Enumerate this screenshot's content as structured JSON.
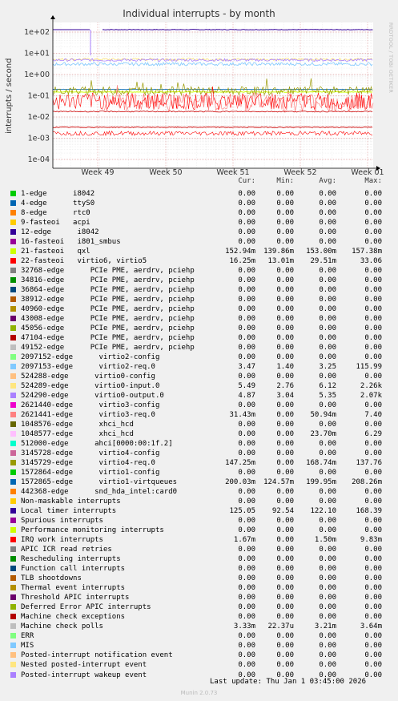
{
  "chart_data": {
    "type": "line",
    "title": "Individual interrupts - by month",
    "ylabel": "interrupts / second",
    "yscale": "log",
    "ylim": [
      0.0001,
      100
    ],
    "y_ticks": [
      "1e+02",
      "1e+01",
      "1e+00",
      "1e-01",
      "1e-02",
      "1e-03",
      "1e-04"
    ],
    "x_ticks": [
      "Week 49",
      "Week 50",
      "Week 51",
      "Week 52",
      "Week 01"
    ],
    "grid": true,
    "approx_lines": [
      {
        "name": "21-fasteoi   qxl",
        "level": 150,
        "color": "#330099"
      },
      {
        "name": "Local timer interrupts",
        "level": 2,
        "color": "#00ccff"
      },
      {
        "name": "virtio",
        "level": 0.15,
        "color": "#88aa00"
      },
      {
        "name": "22-fasteoi",
        "level": 0.02,
        "color": "#cc0000"
      },
      {
        "name": "Machine check polls",
        "level": 0.0033,
        "color": "#cc0000"
      }
    ]
  },
  "watermark": "RRDTOOL / TOBI OETIKER",
  "headers": {
    "cur": "Cur:",
    "min": "Min:",
    "avg": "Avg:",
    "max": "Max:"
  },
  "rows": [
    {
      "name": "1-edge      i8042",
      "color": "#00cc00",
      "cur": "0.00",
      "min": "0.00",
      "avg": "0.00",
      "max": "0.00"
    },
    {
      "name": "4-edge      ttyS0",
      "color": "#0066b3",
      "cur": "0.00",
      "min": "0.00",
      "avg": "0.00",
      "max": "0.00"
    },
    {
      "name": "8-edge      rtc0",
      "color": "#ff8000",
      "cur": "0.00",
      "min": "0.00",
      "avg": "0.00",
      "max": "0.00"
    },
    {
      "name": "9-fasteoi   acpi",
      "color": "#ffcc00",
      "cur": "0.00",
      "min": "0.00",
      "avg": "0.00",
      "max": "0.00"
    },
    {
      "name": "12-edge      i8042",
      "color": "#330099",
      "cur": "0.00",
      "min": "0.00",
      "avg": "0.00",
      "max": "0.00"
    },
    {
      "name": "16-fasteoi   i801_smbus",
      "color": "#990099",
      "cur": "0.00",
      "min": "0.00",
      "avg": "0.00",
      "max": "0.00"
    },
    {
      "name": "21-fasteoi   qxl",
      "color": "#ccff00",
      "cur": "152.94m",
      "min": "139.86m",
      "avg": "153.00m",
      "max": "157.38m"
    },
    {
      "name": "22-fasteoi   virtio6, virtio5",
      "color": "#ff0000",
      "cur": "16.25m",
      "min": "13.01m",
      "avg": "29.51m",
      "max": "33.06"
    },
    {
      "name": "32768-edge      PCIe PME, aerdrv, pciehp",
      "color": "#808080",
      "cur": "0.00",
      "min": "0.00",
      "avg": "0.00",
      "max": "0.00"
    },
    {
      "name": "34816-edge      PCIe PME, aerdrv, pciehp",
      "color": "#008f00",
      "cur": "0.00",
      "min": "0.00",
      "avg": "0.00",
      "max": "0.00"
    },
    {
      "name": "36864-edge      PCIe PME, aerdrv, pciehp",
      "color": "#00487d",
      "cur": "0.00",
      "min": "0.00",
      "avg": "0.00",
      "max": "0.00"
    },
    {
      "name": "38912-edge      PCIe PME, aerdrv, pciehp",
      "color": "#b35a00",
      "cur": "0.00",
      "min": "0.00",
      "avg": "0.00",
      "max": "0.00"
    },
    {
      "name": "40960-edge      PCIe PME, aerdrv, pciehp",
      "color": "#b38f00",
      "cur": "0.00",
      "min": "0.00",
      "avg": "0.00",
      "max": "0.00"
    },
    {
      "name": "43008-edge      PCIe PME, aerdrv, pciehp",
      "color": "#6b006b",
      "cur": "0.00",
      "min": "0.00",
      "avg": "0.00",
      "max": "0.00"
    },
    {
      "name": "45056-edge      PCIe PME, aerdrv, pciehp",
      "color": "#8fb300",
      "cur": "0.00",
      "min": "0.00",
      "avg": "0.00",
      "max": "0.00"
    },
    {
      "name": "47104-edge      PCIe PME, aerdrv, pciehp",
      "color": "#b30000",
      "cur": "0.00",
      "min": "0.00",
      "avg": "0.00",
      "max": "0.00"
    },
    {
      "name": "49152-edge      PCIe PME, aerdrv, pciehp",
      "color": "#bebebe",
      "cur": "0.00",
      "min": "0.00",
      "avg": "0.00",
      "max": "0.00"
    },
    {
      "name": "2097152-edge      virtio2-config",
      "color": "#80ff80",
      "cur": "0.00",
      "min": "0.00",
      "avg": "0.00",
      "max": "0.00"
    },
    {
      "name": "2097153-edge      virtio2-req.0",
      "color": "#80c9ff",
      "cur": "3.47",
      "min": "1.40",
      "avg": "3.25",
      "max": "115.99"
    },
    {
      "name": "524288-edge      virtio0-config",
      "color": "#ffc080",
      "cur": "0.00",
      "min": "0.00",
      "avg": "0.00",
      "max": "0.00"
    },
    {
      "name": "524289-edge      virtio0-input.0",
      "color": "#ffe680",
      "cur": "5.49",
      "min": "2.76",
      "avg": "6.12",
      "max": "2.26k"
    },
    {
      "name": "524290-edge      virtio0-output.0",
      "color": "#aa80ff",
      "cur": "4.87",
      "min": "3.04",
      "avg": "5.35",
      "max": "2.07k"
    },
    {
      "name": "2621440-edge      virtio3-config",
      "color": "#ee00cc",
      "cur": "0.00",
      "min": "0.00",
      "avg": "0.00",
      "max": "0.00"
    },
    {
      "name": "2621441-edge      virtio3-req.0",
      "color": "#ff8080",
      "cur": "31.43m",
      "min": "0.00",
      "avg": "50.94m",
      "max": "7.40"
    },
    {
      "name": "1048576-edge      xhci_hcd",
      "color": "#666600",
      "cur": "0.00",
      "min": "0.00",
      "avg": "0.00",
      "max": "0.00"
    },
    {
      "name": "1048577-edge      xhci_hcd",
      "color": "#ffbfff",
      "cur": "0.00",
      "min": "0.00",
      "avg": "23.70m",
      "max": "6.29"
    },
    {
      "name": "512000-edge      ahci[0000:00:1f.2]",
      "color": "#00ffcc",
      "cur": "0.00",
      "min": "0.00",
      "avg": "0.00",
      "max": "0.00"
    },
    {
      "name": "3145728-edge      virtio4-config",
      "color": "#cc6699",
      "cur": "0.00",
      "min": "0.00",
      "avg": "0.00",
      "max": "0.00"
    },
    {
      "name": "3145729-edge      virtio4-req.0",
      "color": "#999900",
      "cur": "147.25m",
      "min": "0.00",
      "avg": "168.74m",
      "max": "137.76"
    },
    {
      "name": "1572864-edge      virtio1-config",
      "color": "#00cc00",
      "cur": "0.00",
      "min": "0.00",
      "avg": "0.00",
      "max": "0.00"
    },
    {
      "name": "1572865-edge      virtio1-virtqueues",
      "color": "#0066b3",
      "cur": "200.03m",
      "min": "124.57m",
      "avg": "199.95m",
      "max": "208.26m"
    },
    {
      "name": "442368-edge      snd_hda_intel:card0",
      "color": "#ff8000",
      "cur": "0.00",
      "min": "0.00",
      "avg": "0.00",
      "max": "0.00"
    },
    {
      "name": "Non-maskable interrupts",
      "color": "#ffcc00",
      "cur": "0.00",
      "min": "0.00",
      "avg": "0.00",
      "max": "0.00"
    },
    {
      "name": "Local timer interrupts",
      "color": "#330099",
      "cur": "125.05",
      "min": "92.54",
      "avg": "122.10",
      "max": "168.39"
    },
    {
      "name": "Spurious interrupts",
      "color": "#990099",
      "cur": "0.00",
      "min": "0.00",
      "avg": "0.00",
      "max": "0.00"
    },
    {
      "name": "Performance monitoring interrupts",
      "color": "#ccff00",
      "cur": "0.00",
      "min": "0.00",
      "avg": "0.00",
      "max": "0.00"
    },
    {
      "name": "IRQ work interrupts",
      "color": "#ff0000",
      "cur": "1.67m",
      "min": "0.00",
      "avg": "1.50m",
      "max": "9.83m"
    },
    {
      "name": "APIC ICR read retries",
      "color": "#808080",
      "cur": "0.00",
      "min": "0.00",
      "avg": "0.00",
      "max": "0.00"
    },
    {
      "name": "Rescheduling interrupts",
      "color": "#008f00",
      "cur": "0.00",
      "min": "0.00",
      "avg": "0.00",
      "max": "0.00"
    },
    {
      "name": "Function call interrupts",
      "color": "#00487d",
      "cur": "0.00",
      "min": "0.00",
      "avg": "0.00",
      "max": "0.00"
    },
    {
      "name": "TLB shootdowns",
      "color": "#b35a00",
      "cur": "0.00",
      "min": "0.00",
      "avg": "0.00",
      "max": "0.00"
    },
    {
      "name": "Thermal event interrupts",
      "color": "#b38f00",
      "cur": "0.00",
      "min": "0.00",
      "avg": "0.00",
      "max": "0.00"
    },
    {
      "name": "Threshold APIC interrupts",
      "color": "#6b006b",
      "cur": "0.00",
      "min": "0.00",
      "avg": "0.00",
      "max": "0.00"
    },
    {
      "name": "Deferred Error APIC interrupts",
      "color": "#8fb300",
      "cur": "0.00",
      "min": "0.00",
      "avg": "0.00",
      "max": "0.00"
    },
    {
      "name": "Machine check exceptions",
      "color": "#b30000",
      "cur": "0.00",
      "min": "0.00",
      "avg": "0.00",
      "max": "0.00"
    },
    {
      "name": "Machine check polls",
      "color": "#bebebe",
      "cur": "3.33m",
      "min": "22.37u",
      "avg": "3.21m",
      "max": "3.64m"
    },
    {
      "name": "ERR",
      "color": "#80ff80",
      "cur": "0.00",
      "min": "0.00",
      "avg": "0.00",
      "max": "0.00"
    },
    {
      "name": "MIS",
      "color": "#80c9ff",
      "cur": "0.00",
      "min": "0.00",
      "avg": "0.00",
      "max": "0.00"
    },
    {
      "name": "Posted-interrupt notification event",
      "color": "#ffc080",
      "cur": "0.00",
      "min": "0.00",
      "avg": "0.00",
      "max": "0.00"
    },
    {
      "name": "Nested posted-interrupt event",
      "color": "#ffe680",
      "cur": "0.00",
      "min": "0.00",
      "avg": "0.00",
      "max": "0.00"
    },
    {
      "name": "Posted-interrupt wakeup event",
      "color": "#aa80ff",
      "cur": "0.00",
      "min": "0.00",
      "avg": "0.00",
      "max": "0.00"
    }
  ],
  "footer": "Last update: Thu Jan  1 03:45:00 2026",
  "munin": "Munin 2.0.73"
}
